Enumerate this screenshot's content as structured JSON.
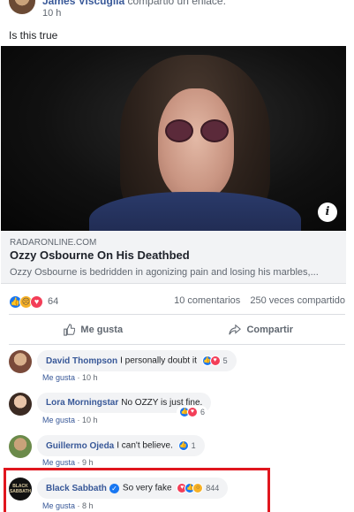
{
  "post": {
    "author": "James Viscuglia",
    "action": "compartió un enlace.",
    "time": "10 h",
    "text": "Is this true"
  },
  "link": {
    "domain": "RADARONLINE.COM",
    "title": "Ozzy Osbourne On His Deathbed",
    "description": "Ozzy Osbourne is bedridden in agonizing pain and losing his marbles,..."
  },
  "reactions": {
    "count": "64",
    "comments": "10 comentarios",
    "shares": "250 veces compartido"
  },
  "actions": {
    "like": "Me gusta",
    "share": "Compartir"
  },
  "comments": [
    {
      "name": "David Thompson",
      "text": "I personally doubt it",
      "reactions": "5",
      "like": "Me gusta",
      "time": "10 h"
    },
    {
      "name": "Lora Morningstar",
      "text": "No OZZY is just fine.",
      "reactions": "6",
      "like": "Me gusta",
      "time": "10 h"
    },
    {
      "name": "Guillermo Ojeda",
      "text": "I can't believe.",
      "reactions": "1",
      "like": "Me gusta",
      "time": "9 h"
    },
    {
      "name": "Black Sabbath",
      "text": "So very fake",
      "reactions": "844",
      "like": "Me gusta",
      "time": "8 h",
      "avatar_text": "BLACK SABBATH"
    }
  ],
  "colors": {
    "link": "#385898",
    "like": "#1877f2",
    "love": "#f33e58",
    "highlight": "#e0161e"
  }
}
